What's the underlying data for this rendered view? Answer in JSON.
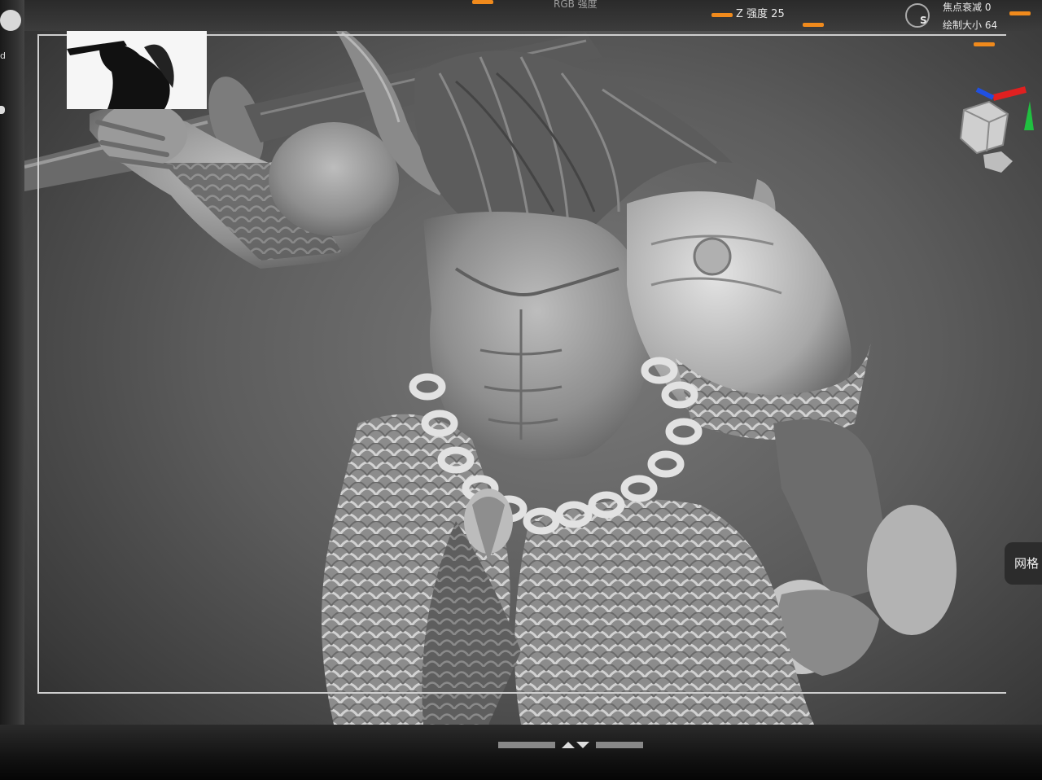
{
  "toolbar": {
    "rgb_strength_label": "RGB 强度",
    "z_intensity_label": "Z 强度 25",
    "focal_shift_label": "焦点衰减 0",
    "draw_size_label": "绘制大小 64",
    "s_label": "S"
  },
  "left_panel": {
    "label": "d"
  },
  "right_panel": {
    "mesh_button_label": "网格"
  },
  "colors": {
    "accent": "#f08a1c",
    "axis_red": "#e02020",
    "axis_green": "#20c040",
    "axis_blue": "#2050e0"
  },
  "icons": {
    "brush": "brush-icon",
    "gizmo": "navigation-cube-icon",
    "collapse": "collapse-toggle-icon"
  }
}
